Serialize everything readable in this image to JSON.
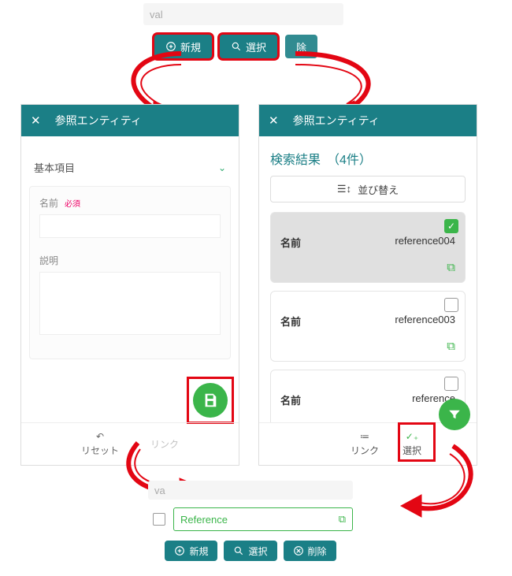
{
  "top_placeholder": "val",
  "top_buttons": {
    "new": "新規",
    "select": "選択",
    "delete_partial": "除"
  },
  "panel_title": "参照エンティティ",
  "left": {
    "section": "基本項目",
    "name_label": "名前",
    "required": "必須",
    "desc_label": "説明",
    "reset": "リセット",
    "link": "リンク"
  },
  "right": {
    "title_prefix": "検索結果　（",
    "count": "4",
    "title_suffix": "件）",
    "sort": "並び替え",
    "name_label": "名前",
    "items": [
      {
        "value": "reference004",
        "checked": true
      },
      {
        "value": "reference003",
        "checked": false
      },
      {
        "value_partial": "reference",
        "checked": false
      }
    ],
    "link": "リンク",
    "select": "選択"
  },
  "bottom": {
    "placeholder": "va",
    "ref_text": "Reference",
    "new": "新規",
    "select": "選択",
    "delete": "削除"
  }
}
